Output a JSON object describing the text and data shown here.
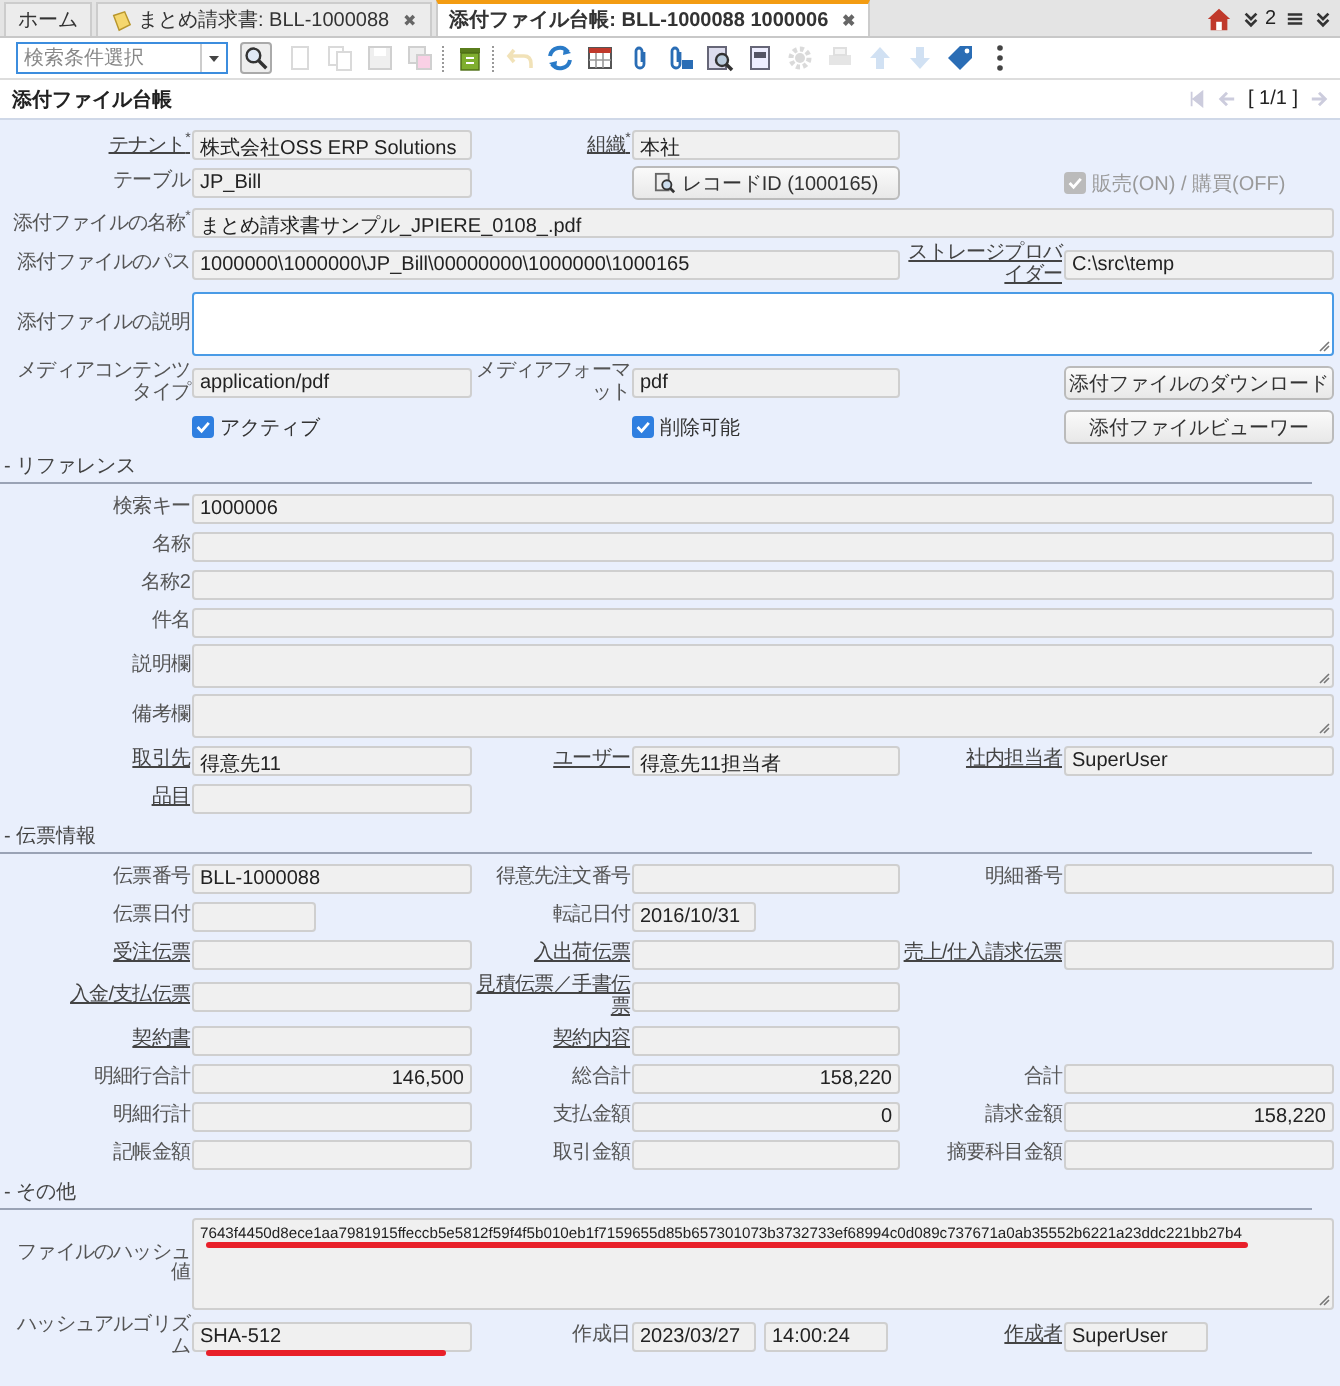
{
  "tab_bar": {
    "tabs": [
      {
        "label": "ホーム",
        "selected": false,
        "icon": false,
        "closable": false
      },
      {
        "label": "まとめ請求書: BLL-1000088",
        "selected": false,
        "icon": true,
        "closable": true
      },
      {
        "label": "添付ファイル台帳: BLL-1000088 1000006",
        "selected": true,
        "icon": false,
        "closable": true
      }
    ],
    "close_glyph": "✖",
    "overflow_count": "2"
  },
  "toolbar": {
    "search": {
      "placeholder": "検索条件選択"
    },
    "tools": [
      {
        "kind": "new",
        "disabled": true
      },
      {
        "kind": "copy",
        "disabled": true
      },
      {
        "kind": "save",
        "disabled": true
      },
      {
        "kind": "save-new",
        "disabled": true
      },
      {
        "kind": "sep"
      },
      {
        "kind": "delete",
        "disabled": false
      },
      {
        "kind": "sep"
      },
      {
        "kind": "undo",
        "disabled": true
      },
      {
        "kind": "refresh",
        "disabled": false
      },
      {
        "kind": "grid",
        "disabled": false
      },
      {
        "kind": "attach",
        "disabled": false
      },
      {
        "kind": "attach-list",
        "disabled": false
      },
      {
        "kind": "zoom",
        "disabled": false
      },
      {
        "kind": "report",
        "disabled": false
      },
      {
        "kind": "gear",
        "disabled": true
      },
      {
        "kind": "print",
        "disabled": true
      },
      {
        "kind": "up",
        "disabled": true
      },
      {
        "kind": "down",
        "disabled": true
      },
      {
        "kind": "tag",
        "disabled": false
      },
      {
        "kind": "more",
        "disabled": false
      }
    ]
  },
  "title_bar": {
    "title": "添付ファイル台帳",
    "record": "[ 1/1 ]"
  },
  "sections": [
    {
      "rows": [
        [
          {
            "kind": "text",
            "label": "テナント$^{*}$",
            "link": true,
            "value": "株式会社OSS ERP Solutions"
          },
          {
            "kind": "text",
            "label": "組織$^{*}$",
            "link": true,
            "value": "本社"
          },
          null
        ],
        [
          {
            "kind": "text",
            "label": "テーブル",
            "value": "JP_Bill"
          },
          {
            "kind": "button",
            "value": "レコードID (1000165)",
            "icon": true
          },
          {
            "kind": "checkbox",
            "value": "販売(ON) / 購買(OFF)",
            "checked": true,
            "disabled": true
          }
        ],
        [
          {
            "kind": "wide",
            "label": "添付ファイルの名称$^{*}$",
            "value": "まとめ請求書サンプル_JPIERE_0108_.pdf"
          }
        ],
        [
          {
            "kind": "wide2",
            "label": "添付ファイルのパス",
            "value": "1000000\\1000000\\JP_Bill\\00000000\\1000000\\1000165"
          },
          {
            "kind": "text",
            "label": "ストレージプロバイダー",
            "link": true,
            "value": "C:\\src\\temp"
          }
        ],
        [
          {
            "kind": "memo-medium",
            "label": "添付ファイルの説明",
            "focused": true
          }
        ],
        [
          {
            "kind": "text",
            "label": "メディアコンテンツタイプ",
            "value": "application/pdf"
          },
          {
            "kind": "text",
            "label": "メディアフォーマット",
            "value": "pdf"
          },
          {
            "kind": "button",
            "value": "添付ファイルのダウンロード"
          }
        ],
        [
          {
            "kind": "checkbox",
            "value": "アクティブ",
            "checked": true,
            "disabled": false
          },
          {
            "kind": "checkbox",
            "value": "削除可能",
            "checked": true,
            "disabled": false
          },
          {
            "kind": "button",
            "value": "添付ファイルビューワー"
          }
        ]
      ]
    },
    {
      "title": "- リファレンス",
      "rows": [
        [
          {
            "kind": "wide",
            "label": "検索キー",
            "value": "1000006"
          }
        ],
        [
          {
            "kind": "wide",
            "label": "名称"
          }
        ],
        [
          {
            "kind": "wide",
            "label": "名称2"
          }
        ],
        [
          {
            "kind": "wide",
            "label": "件名"
          }
        ],
        [
          {
            "kind": "memo",
            "label": "説明欄"
          }
        ],
        [
          {
            "kind": "memo",
            "label": "備考欄"
          }
        ],
        [
          {
            "kind": "text",
            "label": "取引先",
            "link": true,
            "value": "得意先11"
          },
          {
            "kind": "text",
            "label": "ユーザー",
            "link": true,
            "value": "得意先11担当者"
          },
          {
            "kind": "text",
            "label": "社内担当者",
            "link": true,
            "value": "SuperUser"
          }
        ],
        [
          {
            "kind": "text",
            "label": "品目",
            "link": true
          }
        ]
      ]
    },
    {
      "title": "- 伝票情報",
      "rows": [
        [
          {
            "kind": "text",
            "label": "伝票番号",
            "value": "BLL-1000088"
          },
          {
            "kind": "text",
            "label": "得意先注文番号"
          },
          {
            "kind": "text",
            "label": "明細番号"
          }
        ],
        [
          {
            "kind": "short",
            "label": "伝票日付"
          },
          {
            "kind": "short",
            "label": "転記日付",
            "value": "2016/10/31"
          },
          null
        ],
        [
          {
            "kind": "text",
            "label": "受注伝票",
            "link": true
          },
          {
            "kind": "text",
            "label": "入出荷伝票",
            "link": true
          },
          {
            "kind": "text",
            "label": "売上/仕入請求伝票",
            "link": true
          }
        ],
        [
          {
            "kind": "text",
            "label": "入金/支払伝票",
            "link": true
          },
          {
            "kind": "text",
            "label": "見積伝票／手書伝票",
            "link": true
          },
          null
        ],
        [
          {
            "kind": "text",
            "label": "契約書",
            "link": true
          },
          {
            "kind": "text",
            "label": "契約内容",
            "link": true
          },
          null
        ],
        [
          {
            "kind": "amount",
            "label": "明細行合計",
            "value": "146,500"
          },
          {
            "kind": "amount",
            "label": "総合計",
            "value": "158,220"
          },
          {
            "kind": "amount",
            "label": "合計"
          }
        ],
        [
          {
            "kind": "amount",
            "label": "明細行計"
          },
          {
            "kind": "amount",
            "label": "支払金額",
            "value": "0"
          },
          {
            "kind": "amount",
            "label": "請求金額",
            "value": "158,220"
          }
        ],
        [
          {
            "kind": "amount",
            "label": "記帳金額"
          },
          {
            "kind": "amount",
            "label": "取引金額"
          },
          {
            "kind": "amount",
            "label": "摘要科目金額"
          }
        ]
      ]
    },
    {
      "title": "- その他",
      "rows": [
        [
          {
            "kind": "memo-large",
            "label": "ファイルのハッシュ値",
            "value": "7643f4450d8ece1aa7981915ffeccb5e5812f59f4f5b010eb1f7159655d85b657301073b3732733ef68994c0d089c737671a0ab35552b6221a23ddc221bb27b4",
            "underlined": true
          }
        ],
        [
          {
            "kind": "text",
            "label": "ハッシュアルゴリズム",
            "value": "SHA-512",
            "underlined": true
          },
          {
            "kind": "date-time",
            "label": "作成日",
            "values": [
              "2023/03/27",
              "14:00:24"
            ]
          },
          {
            "kind": "medium",
            "label": "作成者",
            "link": true,
            "value": "SuperUser"
          }
        ]
      ]
    }
  ]
}
